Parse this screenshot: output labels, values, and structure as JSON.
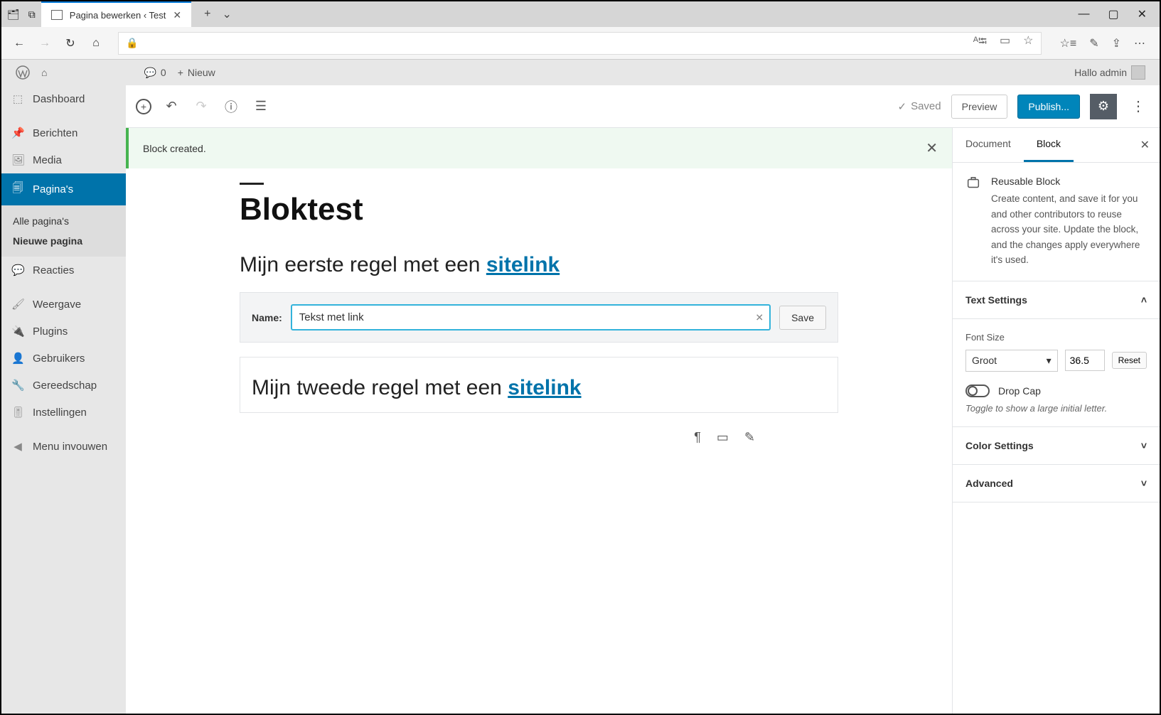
{
  "browser": {
    "tab_title": "Pagina bewerken ‹ Test"
  },
  "adminbar": {
    "comments_count": "0",
    "new_label": "Nieuw",
    "greeting": "Hallo admin"
  },
  "sidebar": {
    "dashboard": "Dashboard",
    "berichten": "Berichten",
    "media": "Media",
    "paginas": "Pagina's",
    "sub_all": "Alle pagina's",
    "sub_new": "Nieuwe pagina",
    "reacties": "Reacties",
    "weergave": "Weergave",
    "plugins": "Plugins",
    "gebruikers": "Gebruikers",
    "gereedschap": "Gereedschap",
    "instellingen": "Instellingen",
    "collapse": "Menu invouwen"
  },
  "editor_header": {
    "saved": "Saved",
    "preview": "Preview",
    "publish": "Publish..."
  },
  "notice": "Block created.",
  "content": {
    "title": "Bloktest",
    "para1_text": "Mijn eerste regel met een ",
    "para1_link": "sitelink",
    "block_name_label": "Name:",
    "block_name_value": "Tekst met link",
    "save_btn": "Save",
    "para2_text": "Mijn tweede regel met een ",
    "para2_link": "sitelink"
  },
  "panel": {
    "tab_document": "Document",
    "tab_block": "Block",
    "reusable_title": "Reusable Block",
    "reusable_desc": "Create content, and save it for you and other contributors to reuse across your site. Update the block, and the changes apply everywhere it's used.",
    "text_settings": "Text Settings",
    "font_size_label": "Font Size",
    "font_size_select": "Groot",
    "font_size_value": "36.5",
    "reset": "Reset",
    "drop_cap": "Drop Cap",
    "drop_cap_hint": "Toggle to show a large initial letter.",
    "color_settings": "Color Settings",
    "advanced": "Advanced"
  }
}
